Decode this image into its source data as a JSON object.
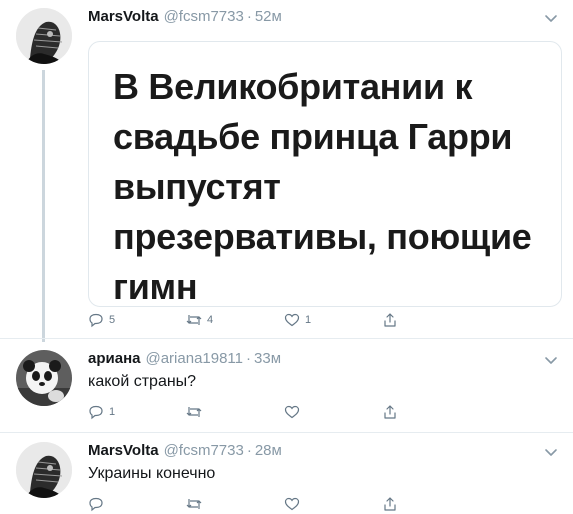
{
  "tweets": [
    {
      "author": "MarsVolta",
      "handle": "@fcsm7733",
      "separator": "·",
      "time": "52м",
      "card_text": "В Великобритании к свадьбе принца Гарри выпустят презервативы, поющие гимн",
      "replies": "5",
      "retweets": "4",
      "likes": "1"
    },
    {
      "author": "ариана",
      "handle": "@ariana19811",
      "separator": "·",
      "time": "33м",
      "text": "какой страны?",
      "replies": "1",
      "retweets": "",
      "likes": ""
    },
    {
      "author": "MarsVolta",
      "handle": "@fcsm7733",
      "separator": "·",
      "time": "28м",
      "text": "Украины конечно",
      "replies": "",
      "retweets": "",
      "likes": ""
    }
  ],
  "colors": {
    "muted": "#8899a6",
    "icon": "#657786",
    "divider": "#e6ecf0",
    "thread_line": "#ccd6dd"
  },
  "icons": [
    "reply-icon",
    "retweet-icon",
    "like-icon",
    "share-icon",
    "chevron-down-icon"
  ]
}
